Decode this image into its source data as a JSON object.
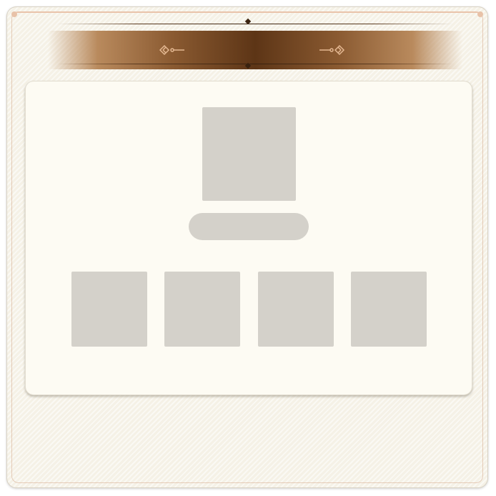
{
  "header": {
    "title": "",
    "ornament_left": "flourish-left-icon",
    "ornament_right": "flourish-right-icon"
  },
  "colors": {
    "panel_bg": "#f5f1e6",
    "banner_dark": "#5d3516",
    "banner_mid": "#8a5a31",
    "card_bg": "#fdfbf3",
    "placeholder": "#d4d1ca",
    "accent_frame": "#e9c3aa"
  },
  "content": {
    "main_item": {
      "label": ""
    },
    "items": [
      {
        "label": ""
      },
      {
        "label": ""
      },
      {
        "label": ""
      },
      {
        "label": ""
      }
    ]
  }
}
